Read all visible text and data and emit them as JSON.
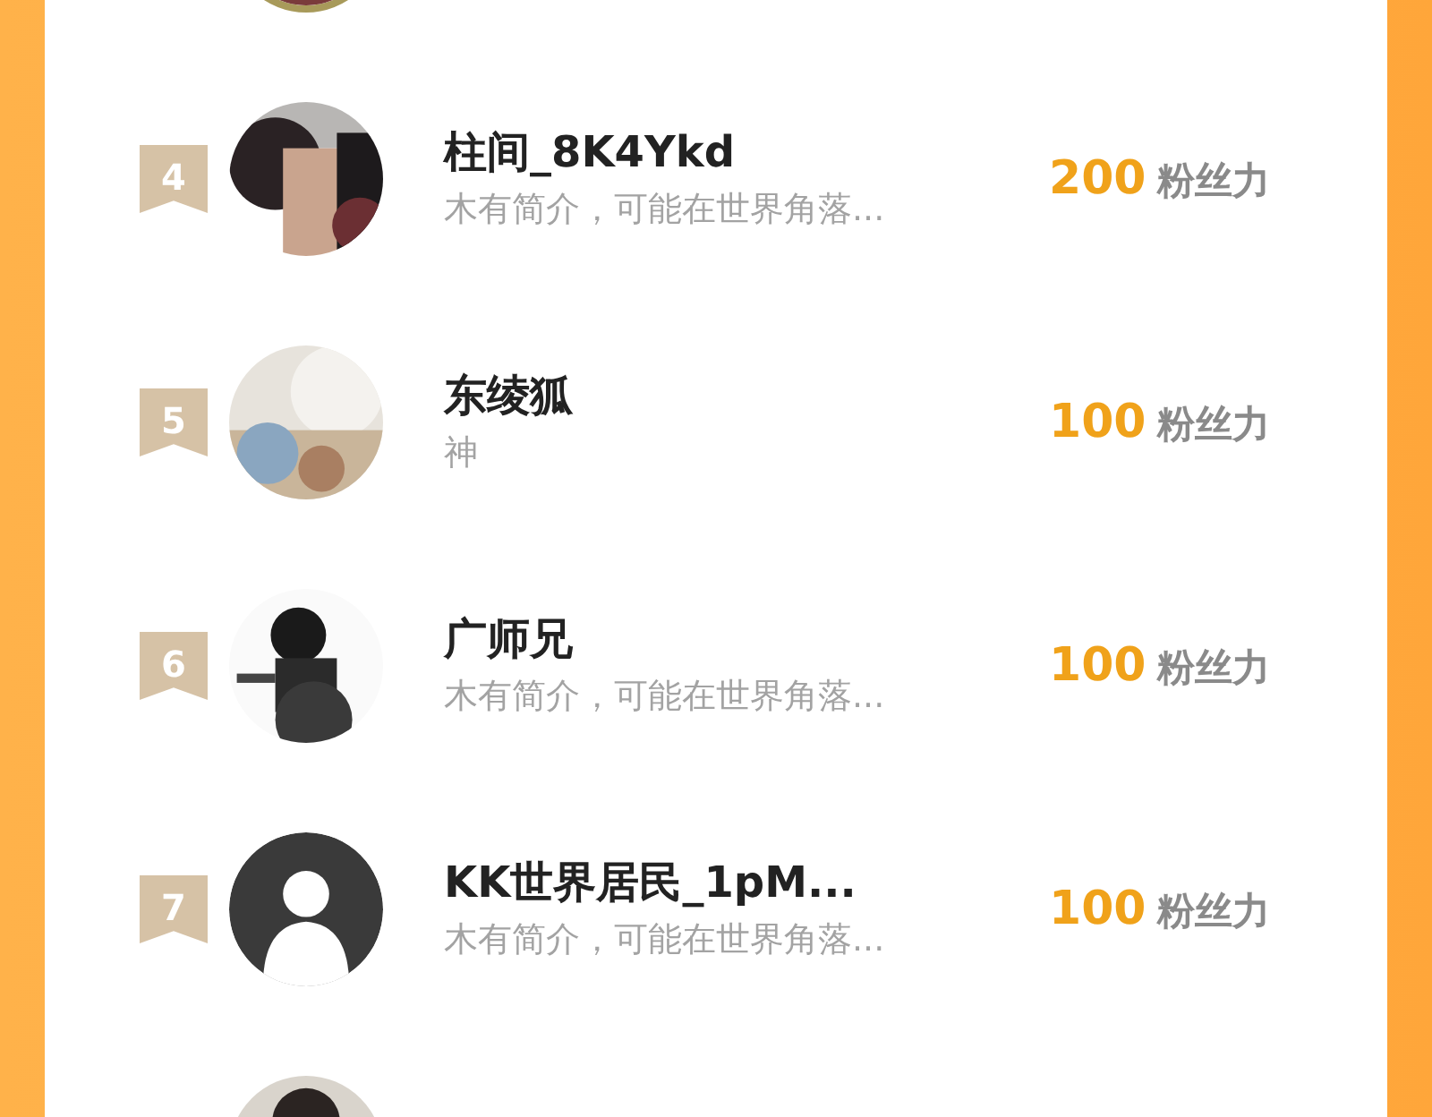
{
  "rows": [
    {
      "avatar": {
        "kind": "picture",
        "framed": true
      }
    },
    {
      "rank": "4",
      "name": "柱间_8K4Ykd",
      "bio": "木有简介，可能在世界角落...",
      "count": "200",
      "unit": "粉丝力",
      "avatar": {
        "kind": "picture",
        "framed": false
      }
    },
    {
      "rank": "5",
      "name": "东绫狐",
      "bio": "神",
      "count": "100",
      "unit": "粉丝力",
      "avatar": {
        "kind": "picture",
        "framed": false
      }
    },
    {
      "rank": "6",
      "name": "广师兄",
      "bio": "木有简介，可能在世界角落...",
      "count": "100",
      "unit": "粉丝力",
      "avatar": {
        "kind": "picture",
        "framed": false
      }
    },
    {
      "rank": "7",
      "name": "KK世界居民_1pM...",
      "bio": "木有简介，可能在世界角落...",
      "count": "100",
      "unit": "粉丝力",
      "avatar": {
        "kind": "default",
        "framed": false
      }
    },
    {
      "avatar": {
        "kind": "picture",
        "framed": false
      }
    }
  ]
}
